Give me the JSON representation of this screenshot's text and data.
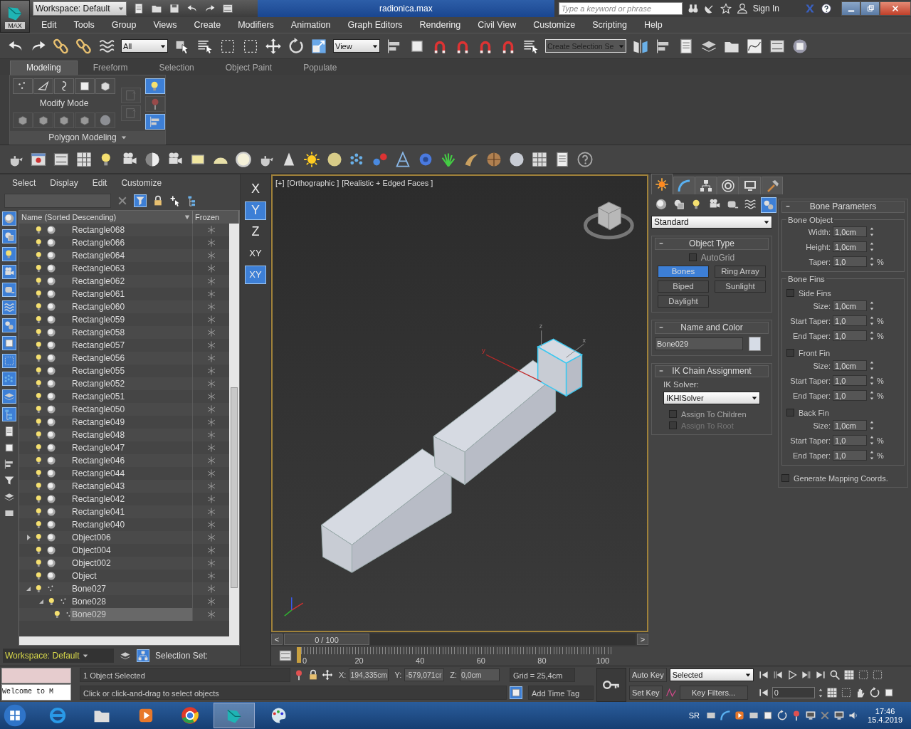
{
  "title_bar": {
    "app_button": "MAX",
    "workspace": "Workspace: Default",
    "title": "radionica.max",
    "search_placeholder": "Type a keyword or phrase",
    "sign_in": "Sign In"
  },
  "menu": [
    "Edit",
    "Tools",
    "Group",
    "Views",
    "Create",
    "Modifiers",
    "Animation",
    "Graph Editors",
    "Rendering",
    "Civil View",
    "Customize",
    "Scripting",
    "Help"
  ],
  "main_toolbar": {
    "selection_filter": "All",
    "coordinate_system": "View",
    "named_selection": "Create Selection Se"
  },
  "ribbon": {
    "tabs": [
      {
        "label": "Modeling",
        "selected": true
      },
      {
        "label": "Freeform",
        "selected": false
      },
      {
        "label": "Selection",
        "selected": false
      },
      {
        "label": "Object Paint",
        "selected": false
      },
      {
        "label": "Populate",
        "selected": false
      }
    ],
    "panel_title": "Modify Mode",
    "panel_footer": "Polygon Modeling"
  },
  "scene_explorer": {
    "menu": [
      "Select",
      "Display",
      "Edit",
      "Customize"
    ],
    "columns": [
      "Name (Sorted Descending)",
      "Frozen"
    ],
    "rows": [
      {
        "name": "Rectangle068",
        "kind": "object",
        "selected": false
      },
      {
        "name": "Rectangle066",
        "kind": "object",
        "selected": false
      },
      {
        "name": "Rectangle064",
        "kind": "object",
        "selected": false
      },
      {
        "name": "Rectangle063",
        "kind": "object",
        "selected": false
      },
      {
        "name": "Rectangle062",
        "kind": "object",
        "selected": false
      },
      {
        "name": "Rectangle061",
        "kind": "object",
        "selected": false
      },
      {
        "name": "Rectangle060",
        "kind": "object",
        "selected": false
      },
      {
        "name": "Rectangle059",
        "kind": "object",
        "selected": false
      },
      {
        "name": "Rectangle058",
        "kind": "object",
        "selected": false
      },
      {
        "name": "Rectangle057",
        "kind": "object",
        "selected": false
      },
      {
        "name": "Rectangle056",
        "kind": "object",
        "selected": false
      },
      {
        "name": "Rectangle055",
        "kind": "object",
        "selected": false
      },
      {
        "name": "Rectangle052",
        "kind": "object",
        "selected": false
      },
      {
        "name": "Rectangle051",
        "kind": "object",
        "selected": false
      },
      {
        "name": "Rectangle050",
        "kind": "object",
        "selected": false
      },
      {
        "name": "Rectangle049",
        "kind": "object",
        "selected": false
      },
      {
        "name": "Rectangle048",
        "kind": "object",
        "selected": false
      },
      {
        "name": "Rectangle047",
        "kind": "object",
        "selected": false
      },
      {
        "name": "Rectangle046",
        "kind": "object",
        "selected": false
      },
      {
        "name": "Rectangle044",
        "kind": "object",
        "selected": false
      },
      {
        "name": "Rectangle043",
        "kind": "object",
        "selected": false
      },
      {
        "name": "Rectangle042",
        "kind": "object",
        "selected": false
      },
      {
        "name": "Rectangle041",
        "kind": "object",
        "selected": false
      },
      {
        "name": "Rectangle040",
        "kind": "object",
        "selected": false
      },
      {
        "name": "Object006",
        "kind": "object",
        "selected": false,
        "expanded": false
      },
      {
        "name": "Object004",
        "kind": "object",
        "selected": false
      },
      {
        "name": "Object002",
        "kind": "object",
        "selected": false
      },
      {
        "name": "Object",
        "kind": "object",
        "selected": false
      },
      {
        "name": "Bone027",
        "kind": "bone",
        "selected": false,
        "expanded": true,
        "children": [
          {
            "name": "Bone028",
            "kind": "bone",
            "selected": false,
            "expanded": true,
            "children": [
              {
                "name": "Bone029",
                "kind": "bone",
                "selected": true
              }
            ]
          }
        ]
      }
    ],
    "workspace": "Workspace: Default",
    "selection_set_label": "Selection Set:"
  },
  "axis_constraints": [
    {
      "label": "X",
      "selected": false
    },
    {
      "label": "Y",
      "selected": true
    },
    {
      "label": "Z",
      "selected": false
    },
    {
      "label": "XY",
      "selected": false
    },
    {
      "label": "XY",
      "selected": true
    }
  ],
  "viewport": {
    "labels": [
      "[+]",
      "[Orthographic ]",
      "[Realistic + Edged Faces ]"
    ],
    "gizmo_labels": [
      "z",
      "x",
      "y"
    ]
  },
  "time_slider": {
    "prev": "<",
    "position": "0 / 100",
    "next": ">"
  },
  "track_bar": {
    "ticks": [
      "0",
      "20",
      "40",
      "60",
      "80",
      "100"
    ]
  },
  "command_panel": {
    "tabs": [
      {
        "selected": true
      },
      {
        "selected": false
      },
      {
        "selected": false
      },
      {
        "selected": false
      },
      {
        "selected": false
      },
      {
        "selected": false
      }
    ],
    "categories": [
      {
        "selected": false
      },
      {
        "selected": false
      },
      {
        "selected": false
      },
      {
        "selected": false
      },
      {
        "selected": false
      },
      {
        "selected": false
      },
      {
        "selected": true
      }
    ],
    "subcategory": "Standard",
    "object_type": {
      "title": "Object Type",
      "autogrid": {
        "label": "AutoGrid",
        "checked": false
      },
      "buttons": [
        {
          "label": "Bones",
          "selected": true
        },
        {
          "label": "Ring Array",
          "selected": false
        },
        {
          "label": "Biped",
          "selected": false
        },
        {
          "label": "Sunlight",
          "selected": false
        },
        {
          "label": "Daylight",
          "selected": false
        }
      ]
    },
    "name_and_color": {
      "title": "Name and Color",
      "name": "Bone029",
      "color": "#d6dce6"
    },
    "ik_chain": {
      "title": "IK Chain Assignment",
      "solver_label": "IK Solver:",
      "solver": "IKHISolver",
      "options": [
        {
          "label": "Assign To Children",
          "checked": false,
          "disabled": false
        },
        {
          "label": "Assign To Root",
          "checked": false,
          "disabled": true
        }
      ]
    },
    "bone_parameters": {
      "title": "Bone Parameters",
      "bone_object": {
        "title": "Bone Object",
        "fields": [
          {
            "label": "Width:",
            "value": "1,0cm"
          },
          {
            "label": "Height:",
            "value": "1,0cm"
          },
          {
            "label": "Taper:",
            "value": "1,0",
            "unit": "%"
          }
        ]
      },
      "bone_fins": {
        "title": "Bone Fins",
        "fins": [
          {
            "label": "Side Fins",
            "checked": false,
            "fields": [
              {
                "label": "Size:",
                "value": "1,0cm"
              },
              {
                "label": "Start Taper:",
                "value": "1,0",
                "unit": "%"
              },
              {
                "label": "End Taper:",
                "value": "1,0",
                "unit": "%"
              }
            ]
          },
          {
            "label": "Front Fin",
            "checked": false,
            "fields": [
              {
                "label": "Size:",
                "value": "1,0cm"
              },
              {
                "label": "Start Taper:",
                "value": "1,0",
                "unit": "%"
              },
              {
                "label": "End Taper:",
                "value": "1,0",
                "unit": "%"
              }
            ]
          },
          {
            "label": "Back Fin",
            "checked": false,
            "fields": [
              {
                "label": "Size:",
                "value": "1,0cm"
              },
              {
                "label": "Start Taper:",
                "value": "1,0",
                "unit": "%"
              },
              {
                "label": "End Taper:",
                "value": "1,0",
                "unit": "%"
              }
            ]
          }
        ]
      },
      "mapping": {
        "label": "Generate Mapping Coords.",
        "checked": false
      }
    }
  },
  "status_bar": {
    "listener": "Welcome to M",
    "selection": "1 Object Selected",
    "prompt": "Click or click-and-drag to select objects",
    "x_label": "X:",
    "x": "194,335cm",
    "y_label": "Y:",
    "y": "-579,071cr",
    "z_label": "Z:",
    "z": "0,0cm",
    "grid": "Grid = 25,4cm",
    "time_tag": "Add Time Tag",
    "auto_key": "Auto Key",
    "key_mode": "Selected",
    "set_key": "Set Key",
    "key_filters": "Key Filters...",
    "frame": "0"
  },
  "taskbar": {
    "tasks": [
      {
        "selected": false
      },
      {
        "selected": false
      },
      {
        "selected": false
      },
      {
        "selected": false
      },
      {
        "selected": true
      },
      {
        "selected": false
      }
    ],
    "language": "SR",
    "time": "17:46",
    "date": "15.4.2019"
  }
}
